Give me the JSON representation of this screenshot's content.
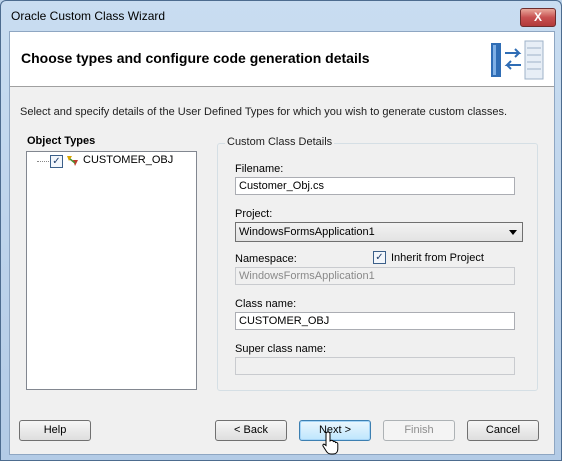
{
  "window": {
    "title": "Oracle Custom Class Wizard",
    "close_label": "X"
  },
  "header": {
    "title": "Choose types and configure code generation details"
  },
  "intro": "Select and specify details of the User Defined Types for which you wish to generate custom classes.",
  "object_types": {
    "label": "Object Types",
    "items": [
      {
        "label": "CUSTOMER_OBJ",
        "checked": true
      }
    ]
  },
  "details": {
    "group_label": "Custom Class Details",
    "filename_label": "Filename:",
    "filename_value": "Customer_Obj.cs",
    "project_label": "Project:",
    "project_value": "WindowsFormsApplication1",
    "namespace_label": "Namespace:",
    "inherit_label": "Inherit from Project",
    "inherit_checked": true,
    "namespace_value": "WindowsFormsApplication1",
    "classname_label": "Class name:",
    "classname_value": "CUSTOMER_OBJ",
    "superclass_label": "Super class name:",
    "superclass_value": ""
  },
  "buttons": {
    "help": "Help",
    "back": "< Back",
    "next": "Next >",
    "finish": "Finish",
    "cancel": "Cancel"
  },
  "colors": {
    "frame": "#bcd3ea",
    "close": "#c75050",
    "default_button": "#3c7fb1"
  }
}
